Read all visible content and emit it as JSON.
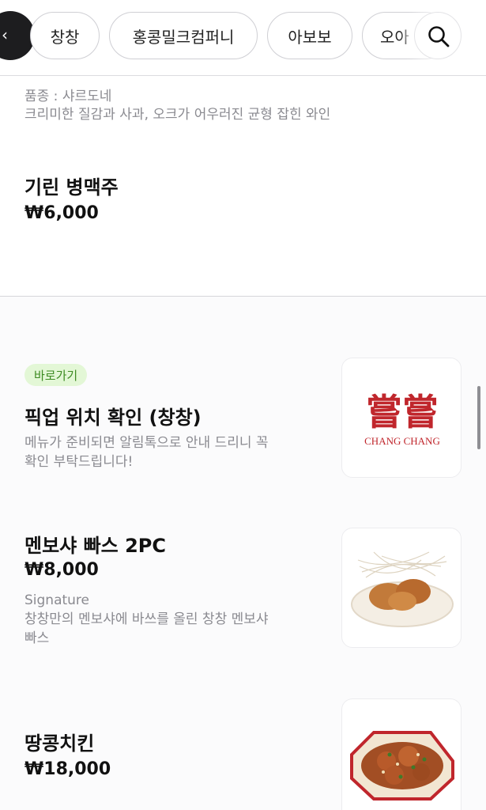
{
  "header": {
    "chips": [
      "창창",
      "홍콩밀크컴퍼니",
      "아보보",
      "오아"
    ],
    "back_icon": "chevron-left-icon",
    "search_icon": "search-icon"
  },
  "wine": {
    "variety": "품종 : 샤르도네",
    "description": "크리미한 질감과 사과, 오크가 어우러진 균형 잡힌 와인"
  },
  "menu_items": [
    {
      "name": "기린 병맥주",
      "price": "₩6,000"
    },
    {
      "badge": "바로가기",
      "name": "픽업 위치 확인 (창창)",
      "description_line1": "메뉴가 준비되면 알림톡으로 안내 드리니 꼭",
      "description_line2": "확인 부탁드립니다!",
      "logo_chinese": "嘗嘗",
      "logo_english": "CHANG CHANG"
    },
    {
      "name": "멘보샤 빠스 2PC",
      "price": "₩8,000",
      "tag": "Signature",
      "description_line1": "창창만의 멘보샤에 바쓰를 올린 창창 멘보샤",
      "description_line2": "빠스"
    },
    {
      "name": "땅콩치킨",
      "price": "₩18,000"
    }
  ],
  "colors": {
    "accent_red": "#c0262c",
    "badge_bg": "#e3f7d6",
    "badge_text": "#3d8b22"
  }
}
